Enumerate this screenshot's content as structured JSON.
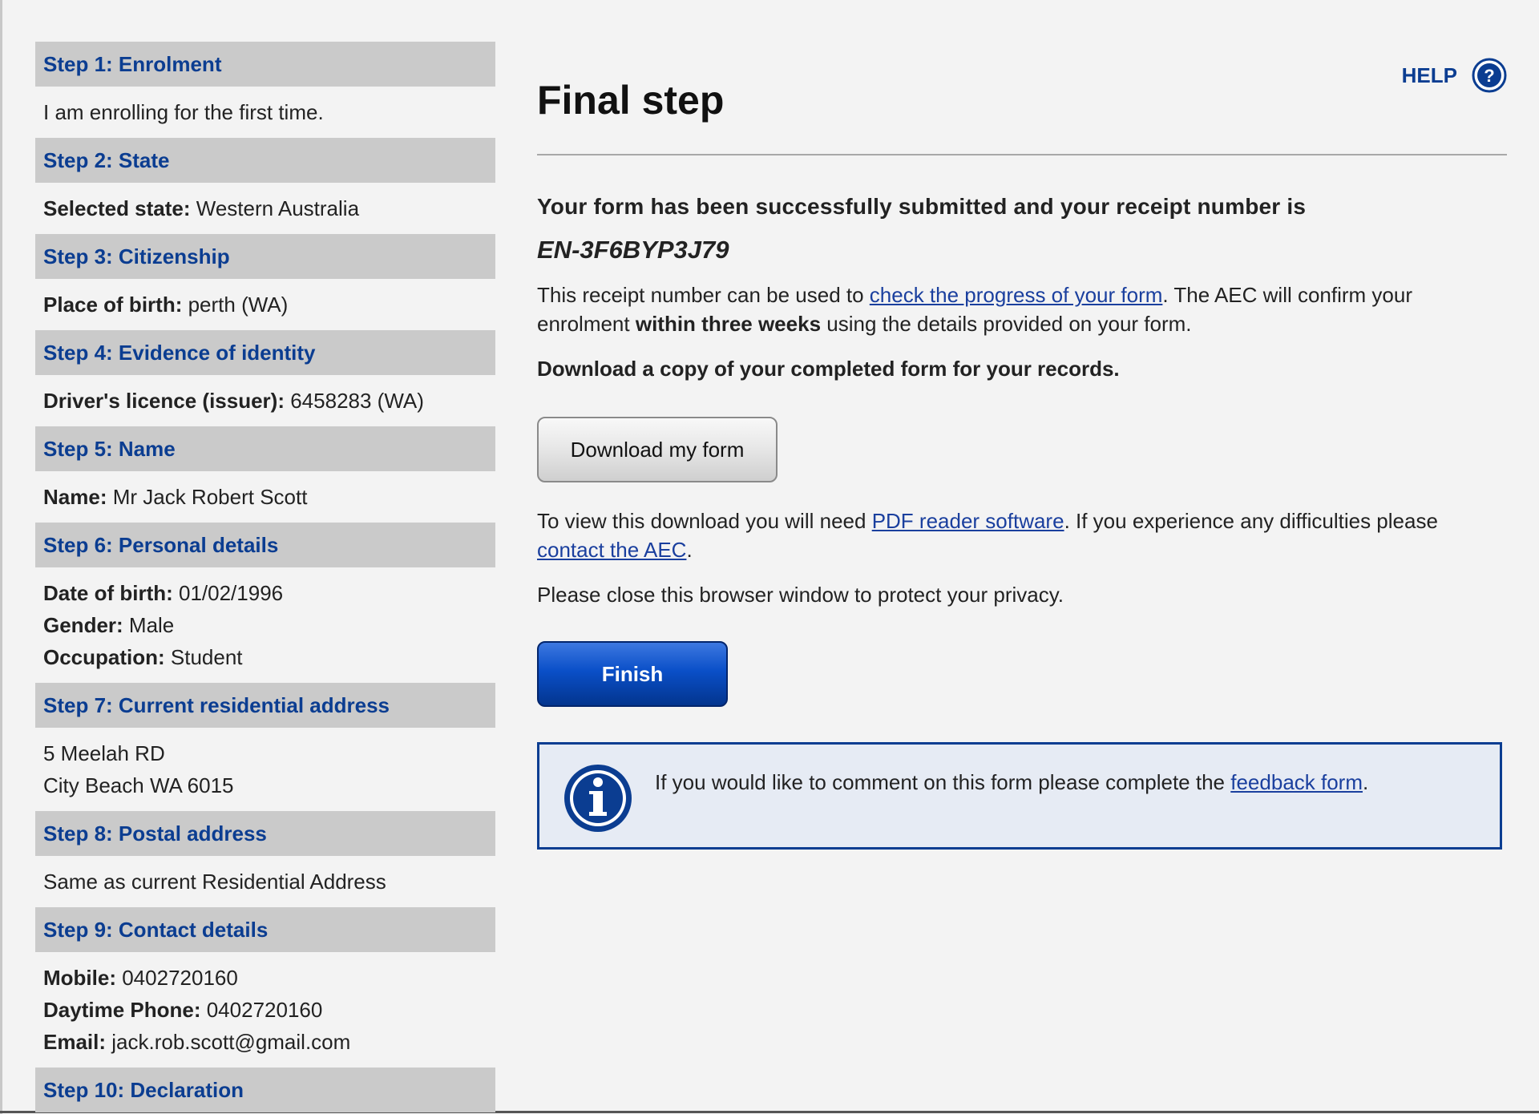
{
  "sidebar": {
    "steps": [
      {
        "header": "Step 1: Enrolment",
        "lines": [
          {
            "label": "",
            "value": "I am enrolling for the first time."
          }
        ]
      },
      {
        "header": "Step 2: State",
        "lines": [
          {
            "label": "Selected state:",
            "value": " Western Australia"
          }
        ]
      },
      {
        "header": "Step 3: Citizenship",
        "lines": [
          {
            "label": "Place of birth:",
            "value": " perth (WA)"
          }
        ]
      },
      {
        "header": "Step 4: Evidence of identity",
        "lines": [
          {
            "label": "Driver's licence (issuer):",
            "value": " 6458283 (WA)"
          }
        ]
      },
      {
        "header": "Step 5: Name",
        "lines": [
          {
            "label": "Name:",
            "value": " Mr Jack Robert Scott"
          }
        ]
      },
      {
        "header": "Step 6: Personal details",
        "lines": [
          {
            "label": "Date of birth:",
            "value": " 01/02/1996"
          },
          {
            "label": "Gender:",
            "value": " Male"
          },
          {
            "label": "Occupation:",
            "value": " Student"
          }
        ]
      },
      {
        "header": "Step 7: Current residential address",
        "lines": [
          {
            "label": "",
            "value": "5 Meelah RD"
          },
          {
            "label": "",
            "value": "City Beach WA 6015"
          }
        ]
      },
      {
        "header": "Step 8: Postal address",
        "lines": [
          {
            "label": "",
            "value": "Same as current Residential Address"
          }
        ]
      },
      {
        "header": "Step 9: Contact details",
        "lines": [
          {
            "label": "Mobile:",
            "value": " 0402720160"
          },
          {
            "label": "Daytime Phone:",
            "value": " 0402720160"
          },
          {
            "label": "Email:",
            "value": " jack.rob.scott@gmail.com"
          }
        ]
      },
      {
        "header": "Step 10: Declaration",
        "lines": []
      }
    ]
  },
  "help": {
    "label": "HELP",
    "icon": "help-icon"
  },
  "main": {
    "title": "Final step",
    "success_text": "Your form has been successfully submitted and your receipt number is",
    "receipt_number": "EN-3F6BYP3J79",
    "receipt_info": {
      "pre": "This receipt number can be used to ",
      "link": "check the progress of your form",
      "mid": ". The AEC will confirm your enrolment ",
      "bold": "within three weeks",
      "post": " using the details provided on your form."
    },
    "download_prompt": "Download a copy of your completed form for your records.",
    "download_button": "Download my form",
    "pdf_info": {
      "pre": "To view this download you will need ",
      "link1": "PDF reader software",
      "mid": ". If you experience any difficulties please ",
      "link2": "contact the AEC",
      "post": "."
    },
    "privacy_text": "Please close this browser window to protect your privacy.",
    "finish_button": "Finish",
    "feedback": {
      "pre": "If you would like to comment on this form please complete the ",
      "link": "feedback form",
      "post": ".",
      "icon": "info-icon"
    }
  },
  "colors": {
    "accent": "#0b3d91",
    "step_header_bg": "#cacaca",
    "info_bg": "#e6ebf4"
  }
}
